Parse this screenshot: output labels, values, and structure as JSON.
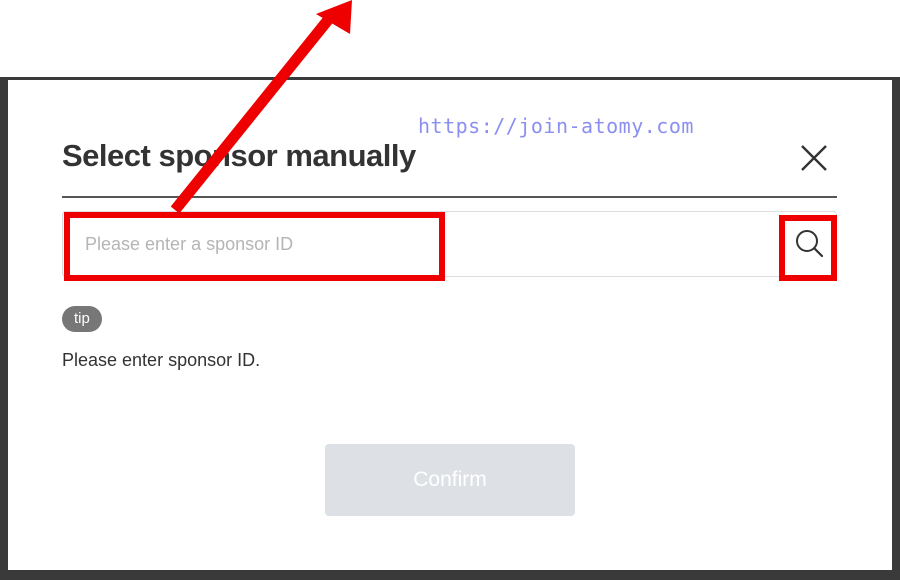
{
  "dialog": {
    "title": "Select sponsor manually",
    "close_icon": "close-icon"
  },
  "search": {
    "placeholder": "Please enter a sponsor ID",
    "value": "",
    "search_icon": "search-icon"
  },
  "watermark": {
    "text": "https://join-atomy.com"
  },
  "tip": {
    "badge": "tip",
    "text": "Please enter sponsor ID."
  },
  "actions": {
    "confirm_label": "Confirm"
  },
  "annotations": {
    "highlight_color": "#ee0000",
    "arrow_icon": "arrow-icon"
  },
  "colors": {
    "confirm_disabled_bg": "#dde0e4",
    "tip_badge_bg": "#777777",
    "watermark": "#8a8ff0"
  }
}
